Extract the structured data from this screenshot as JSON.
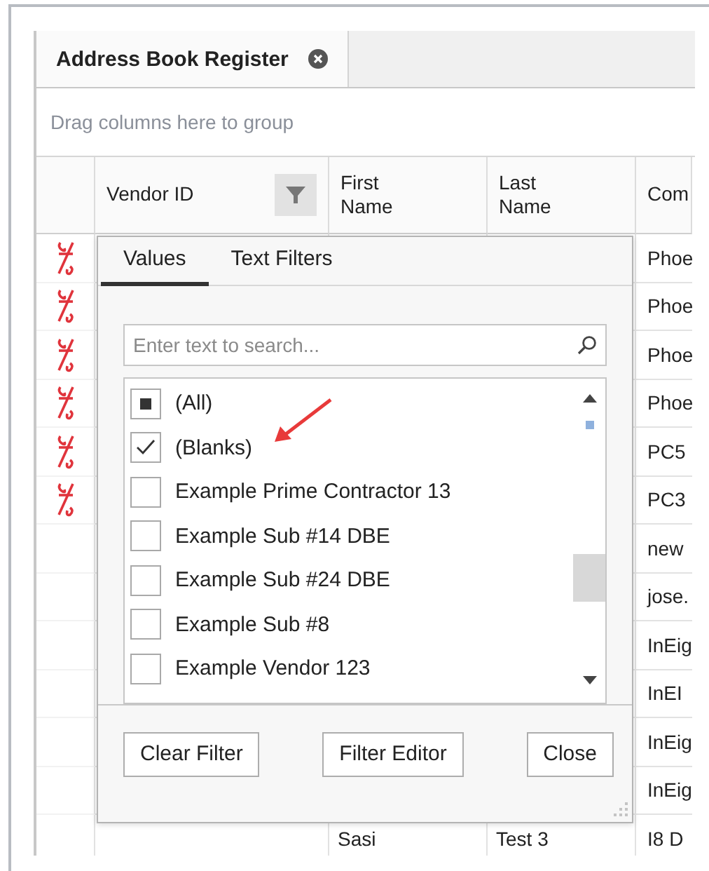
{
  "document_tab": {
    "title": "Address Book Register",
    "selected": true
  },
  "group_panel": {
    "placeholder": "Drag columns here to group"
  },
  "columns": [
    {
      "kind": "indicator"
    },
    {
      "kind": "filter",
      "label": "Vendor ID"
    },
    {
      "kind": "text",
      "label": "First\nName"
    },
    {
      "kind": "text",
      "label": "Last\nName"
    },
    {
      "kind": "text",
      "label": "Com"
    }
  ],
  "rows": [
    {
      "unlinked": true,
      "company": "Phoe"
    },
    {
      "unlinked": true,
      "company": "Phoe"
    },
    {
      "unlinked": true,
      "company": "Phoe"
    },
    {
      "unlinked": true,
      "company": "Phoe"
    },
    {
      "unlinked": true,
      "company": "PC5"
    },
    {
      "unlinked": true,
      "company": "PC3"
    },
    {
      "unlinked": false,
      "company": "new"
    },
    {
      "unlinked": false,
      "company": "jose."
    },
    {
      "unlinked": false,
      "company": "InEig"
    },
    {
      "unlinked": false,
      "company": "InEI"
    },
    {
      "unlinked": false,
      "company": "InEig"
    },
    {
      "unlinked": false,
      "company": "InEig"
    },
    {
      "unlinked": false,
      "first_name": "Sasi",
      "last_name": "Test 3",
      "company": "I8 D"
    }
  ],
  "filter_popup": {
    "tabs": [
      {
        "label": "Values",
        "selected": true
      },
      {
        "label": "Text Filters",
        "selected": false
      }
    ],
    "search": {
      "placeholder": "Enter text to search..."
    },
    "items": [
      {
        "label": "(All)",
        "checked": true,
        "partial": true
      },
      {
        "label": "(Blanks)",
        "checked": true,
        "partial": false
      },
      {
        "label": "Example Prime Contractor 13",
        "checked": false,
        "partial": false
      },
      {
        "label": "Example Sub #14 DBE",
        "checked": false,
        "partial": false
      },
      {
        "label": "Example Sub #24 DBE",
        "checked": false,
        "partial": false
      },
      {
        "label": "Example Sub #8",
        "checked": false,
        "partial": false
      },
      {
        "label": "Example Vendor 123",
        "checked": false,
        "partial": false
      }
    ],
    "buttons": [
      "Clear Filter",
      "Filter Editor",
      "Close"
    ]
  }
}
